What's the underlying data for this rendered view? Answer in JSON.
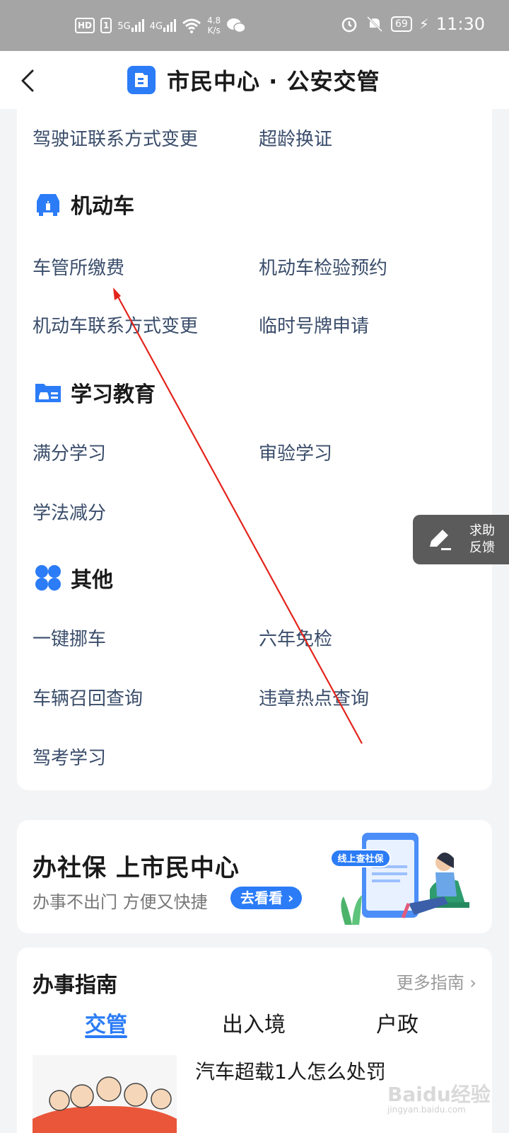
{
  "status_bar": {
    "hd_badge": "HD",
    "sim_label": "1",
    "net1": "5G",
    "net2": "4G",
    "speed_value": "4.8",
    "speed_unit": "K/s",
    "battery": "69",
    "time": "11:30"
  },
  "header": {
    "title": "市民中心 · 公安交管",
    "brand_color": "#2b7cf6"
  },
  "services": {
    "top_row": [
      "驾驶证联系方式变更",
      "超龄换证"
    ],
    "vehicle": {
      "title": "机动车",
      "items": [
        "车管所缴费",
        "机动车检验预约",
        "机动车联系方式变更",
        "临时号牌申请"
      ]
    },
    "education": {
      "title": "学习教育",
      "items": [
        "满分学习",
        "审验学习",
        "学法减分"
      ]
    },
    "other": {
      "title": "其他",
      "items": [
        "一键挪车",
        "六年免检",
        "车辆召回查询",
        "违章热点查询",
        "驾考学习"
      ]
    }
  },
  "feedback": {
    "line1": "求助",
    "line2": "反馈"
  },
  "banner": {
    "title": "办社保 上市民中心",
    "subtitle": "办事不出门 方便又快捷",
    "button": "去看看",
    "art_label": "线上查社保"
  },
  "guide": {
    "title": "办事指南",
    "more": "更多指南",
    "tabs": [
      "交管",
      "出入境",
      "户政"
    ],
    "active_tab": 0,
    "article_title": "汽车超载1人怎么处罚"
  },
  "watermark": {
    "main": "Baidu经验",
    "sub": "jingyan.baidu.com"
  }
}
